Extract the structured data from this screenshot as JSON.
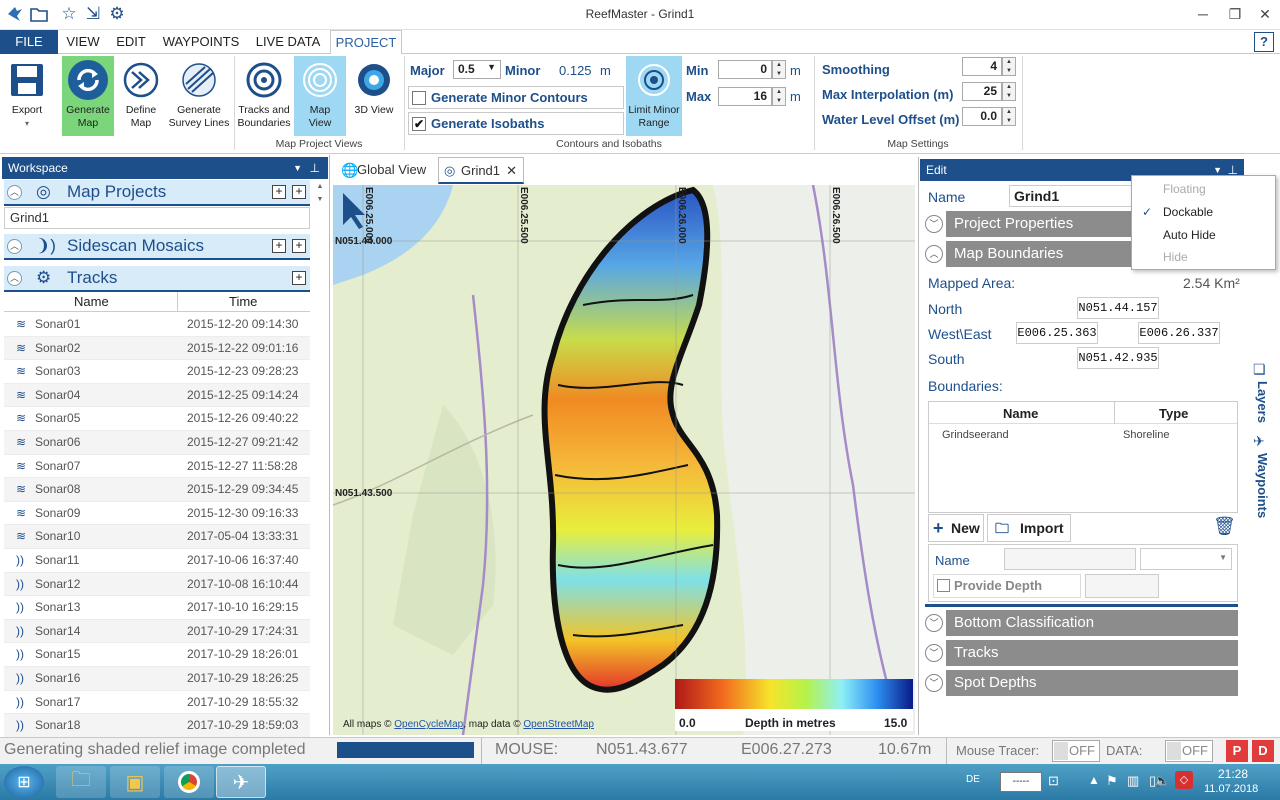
{
  "app": {
    "title": "ReefMaster - Grind1"
  },
  "ribbon_tabs": [
    "FILE",
    "VIEW",
    "EDIT",
    "WAYPOINTS",
    "LIVE DATA",
    "PROJECT"
  ],
  "ribbon": {
    "export": "Export",
    "generate_map": [
      "Generate",
      "Map"
    ],
    "define_map": [
      "Define",
      "Map"
    ],
    "generate_survey": [
      "Generate",
      "Survey Lines"
    ],
    "tracks_boundaries": [
      "Tracks and",
      "Boundaries"
    ],
    "map_view": [
      "Map",
      "View"
    ],
    "view_3d": "3D View",
    "group_map_project_views": "Map Project Views",
    "major_label": "Major",
    "major_value": "0.5",
    "minor_label": "Minor",
    "minor_value": "0.125",
    "minor_unit": "m",
    "generate_minor_contours": "Generate Minor Contours",
    "generate_isobaths": "Generate Isobaths",
    "limit_minor_range": [
      "Limit Minor",
      "Range"
    ],
    "min_label": "Min",
    "min_value": "0",
    "max_label": "Max",
    "max_value": "16",
    "unit_m": "m",
    "group_contours": "Contours and Isobaths",
    "smoothing_label": "Smoothing",
    "smoothing_value": "4",
    "max_interp_label": "Max Interpolation (m)",
    "max_interp_value": "25",
    "water_offset_label": "Water Level Offset (m)",
    "water_offset_value": "0.0",
    "group_map_settings": "Map Settings"
  },
  "workspace": {
    "title": "Workspace",
    "map_projects": "Map Projects",
    "project_item": "Grind1",
    "sidescan": "Sidescan Mosaics",
    "tracks": "Tracks",
    "col_name": "Name",
    "col_time": "Time",
    "rows": [
      {
        "name": "Sonar01",
        "time": "2015-12-20 09:14:30",
        "icon": "sonar"
      },
      {
        "name": "Sonar02",
        "time": "2015-12-22 09:01:16",
        "icon": "sonar"
      },
      {
        "name": "Sonar03",
        "time": "2015-12-23 09:28:23",
        "icon": "sonar"
      },
      {
        "name": "Sonar04",
        "time": "2015-12-25 09:14:24",
        "icon": "sonar"
      },
      {
        "name": "Sonar05",
        "time": "2015-12-26 09:40:22",
        "icon": "sonar"
      },
      {
        "name": "Sonar06",
        "time": "2015-12-27 09:21:42",
        "icon": "sonar"
      },
      {
        "name": "Sonar07",
        "time": "2015-12-27 11:58:28",
        "icon": "sonar"
      },
      {
        "name": "Sonar08",
        "time": "2015-12-29 09:34:45",
        "icon": "sonar"
      },
      {
        "name": "Sonar09",
        "time": "2015-12-30 09:16:33",
        "icon": "sonar"
      },
      {
        "name": "Sonar10",
        "time": "2017-05-04 13:33:31",
        "icon": "sonar"
      },
      {
        "name": "Sonar11",
        "time": "2017-10-06 16:37:40",
        "icon": "sidescan"
      },
      {
        "name": "Sonar12",
        "time": "2017-10-08 16:10:44",
        "icon": "sidescan"
      },
      {
        "name": "Sonar13",
        "time": "2017-10-10 16:29:15",
        "icon": "sidescan"
      },
      {
        "name": "Sonar14",
        "time": "2017-10-29 17:24:31",
        "icon": "sidescan"
      },
      {
        "name": "Sonar15",
        "time": "2017-10-29 18:26:01",
        "icon": "sidescan"
      },
      {
        "name": "Sonar16",
        "time": "2017-10-29 18:26:25",
        "icon": "sidescan"
      },
      {
        "name": "Sonar17",
        "time": "2017-10-29 18:55:32",
        "icon": "sidescan"
      },
      {
        "name": "Sonar18",
        "time": "2017-10-29 18:59:03",
        "icon": "sidescan"
      }
    ]
  },
  "map": {
    "tab_global": "Global View",
    "tab_grind": "Grind1",
    "lon_labels": [
      "E006.25.000",
      "E006.25.500",
      "E006.26.000",
      "E006.26.500"
    ],
    "lat_labels": [
      "N051.44.000",
      "N051.43.500"
    ],
    "attribution_prefix": "All maps ©",
    "attribution_ocm": "OpenCycleMap",
    "attribution_mid": ", map data ©",
    "attribution_osm": "OpenStreetMap",
    "legend_min": "0.0",
    "legend_title": "Depth in metres",
    "legend_max": "15.0"
  },
  "edit": {
    "title": "Edit",
    "name_label": "Name",
    "name_value": "Grind1",
    "project_properties": "Project Properties",
    "map_boundaries": "Map Boundaries",
    "mapped_area_label": "Mapped Area:",
    "mapped_area_value": "2.54 Km²",
    "north_label": "North",
    "north_value": "N051.44.157",
    "westeast_label": "West\\East",
    "west_value": "E006.25.363",
    "east_value": "E006.26.337",
    "south_label": "South",
    "south_value": "N051.42.935",
    "boundaries_label": "Boundaries:",
    "col_name": "Name",
    "col_type": "Type",
    "boundary_name": "Grindseerand",
    "boundary_type": "Shoreline",
    "new_label": "New",
    "import_label": "Import",
    "bname_label": "Name",
    "provide_depth": "Provide Depth",
    "bottom_classification": "Bottom Classification",
    "tracks": "Tracks",
    "spot_depths": "Spot Depths"
  },
  "dock_menu": {
    "items": [
      "Floating",
      "Dockable",
      "Auto Hide",
      "Hide"
    ]
  },
  "side_tabs": {
    "layers": "Layers",
    "waypoints": "Waypoints"
  },
  "status": {
    "message": "Generating shaded relief image completed",
    "mouse_label": "MOUSE:",
    "mouse_lat": "N051.43.677",
    "mouse_lon": "E006.27.273",
    "mouse_depth": "10.67m",
    "tracer_label": "Mouse Tracer:",
    "tracer_value": "OFF",
    "data_label": "DATA:",
    "data_value": "OFF",
    "p_btn": "P",
    "d_btn": "D"
  },
  "taskbar": {
    "lang": "DE",
    "time": "21:28",
    "date": "11.07.2018"
  },
  "colors": {
    "accent": "#1d4f8b",
    "ribbon_highlight": "#9ed8f3",
    "generate_green": "#7bd67b",
    "header_gray": "#8c8c8c"
  }
}
